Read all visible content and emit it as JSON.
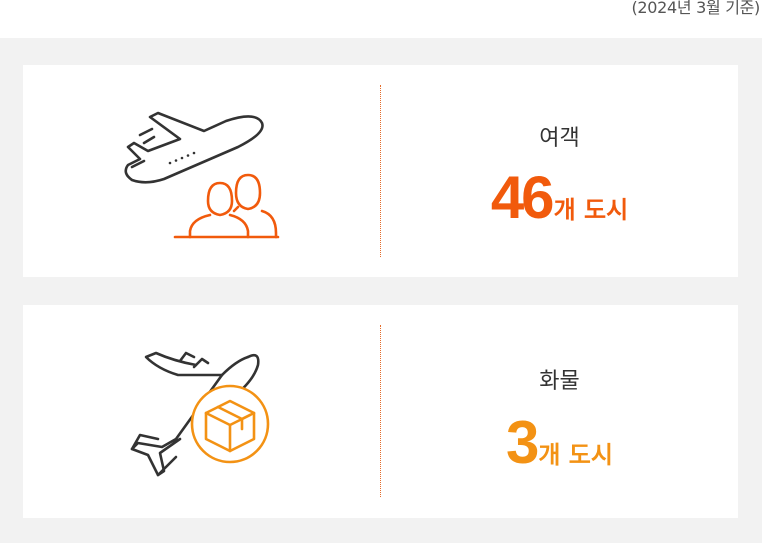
{
  "header": {
    "as_of": "(2024년 3월 기준)"
  },
  "stats": {
    "passenger": {
      "label": "여객",
      "value": "46",
      "unit": "개 도시",
      "icon": "plane-takeoff-people-icon",
      "color": "#f15a0c"
    },
    "cargo": {
      "label": "화물",
      "value": "3",
      "unit": "개 도시",
      "icon": "plane-cargo-box-icon",
      "color": "#f39214"
    }
  },
  "colors": {
    "line_dark": "#333333",
    "divider": "#e46c2a",
    "panel_bg": "#f2f2f2"
  }
}
